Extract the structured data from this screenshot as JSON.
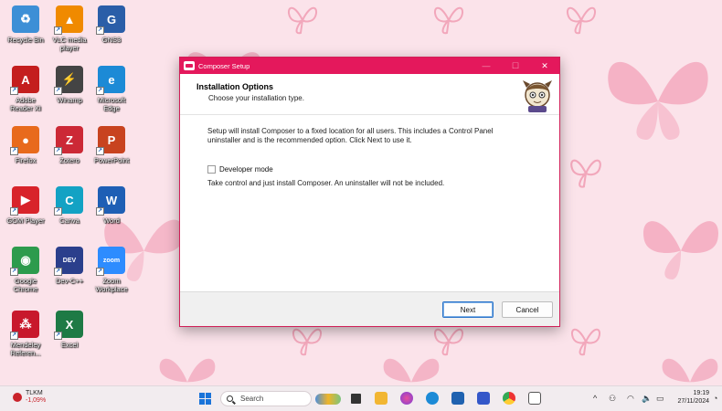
{
  "desktop": {
    "icons": [
      {
        "label": "Recycle Bin",
        "color": "#3d8fd6",
        "icon": "recycle-bin-icon",
        "glyph": "♻"
      },
      {
        "label": "VLC media player",
        "color": "#f08a00",
        "icon": "vlc-icon",
        "glyph": "▲"
      },
      {
        "label": "GNS3",
        "color": "#2a5ea8",
        "icon": "gns3-icon",
        "glyph": "G"
      },
      {
        "label": "Adobe Reader XI",
        "color": "#c41e1e",
        "icon": "adobe-reader-icon",
        "glyph": "A"
      },
      {
        "label": "Winamp",
        "color": "#444444",
        "icon": "winamp-icon",
        "glyph": "⚡"
      },
      {
        "label": "Microsoft Edge",
        "color": "#1c8ad6",
        "icon": "edge-icon",
        "glyph": "e"
      },
      {
        "label": "Firefox",
        "color": "#e86a1c",
        "icon": "firefox-icon",
        "glyph": "●"
      },
      {
        "label": "Zotero",
        "color": "#cc2936",
        "icon": "zotero-icon",
        "glyph": "Z"
      },
      {
        "label": "PowerPoint",
        "color": "#c8431f",
        "icon": "powerpoint-icon",
        "glyph": "P"
      },
      {
        "label": "GOM Player",
        "color": "#d8232a",
        "icon": "gom-player-icon",
        "glyph": "▶"
      },
      {
        "label": "Canva",
        "color": "#13a2c4",
        "icon": "canva-icon",
        "glyph": "C"
      },
      {
        "label": "Word",
        "color": "#1e5fb5",
        "icon": "word-icon",
        "glyph": "W"
      },
      {
        "label": "Google Chrome",
        "color": "#2d9b4d",
        "icon": "chrome-icon",
        "glyph": "◉"
      },
      {
        "label": "Dev-C++",
        "color": "#2b3f8c",
        "icon": "devcpp-icon",
        "glyph": "DEV"
      },
      {
        "label": "Zoom Workplace",
        "color": "#2d8cff",
        "icon": "zoom-icon",
        "glyph": "zoom"
      },
      {
        "label": "Mendeley Referen...",
        "color": "#c8182c",
        "icon": "mendeley-icon",
        "glyph": "⁂"
      },
      {
        "label": "Excel",
        "color": "#1e7a45",
        "icon": "excel-icon",
        "glyph": "X"
      }
    ]
  },
  "dialog": {
    "title": "Composer Setup",
    "minimize": "—",
    "maximize": "☐",
    "close": "✕",
    "header_title": "Installation Options",
    "header_subtitle": "Choose your installation type.",
    "body_text": "Setup will install Composer to a fixed location for all users. This includes a Control Panel uninstaller and is the recommended option. Click Next to use it.",
    "checkbox_label": "Developer mode",
    "checkbox_checked": false,
    "checkbox_description": "Take control and just install Composer. An uninstaller will not be included.",
    "next_label": "Next",
    "cancel_label": "Cancel"
  },
  "taskbar": {
    "weather_title": "TLKM",
    "weather_sub": "-1,09%",
    "search_label": "Search",
    "time": "19:19",
    "date": "27/11/2024",
    "tray": {
      "chevron": "^",
      "wifi": "◠",
      "volume": "🔈"
    }
  }
}
